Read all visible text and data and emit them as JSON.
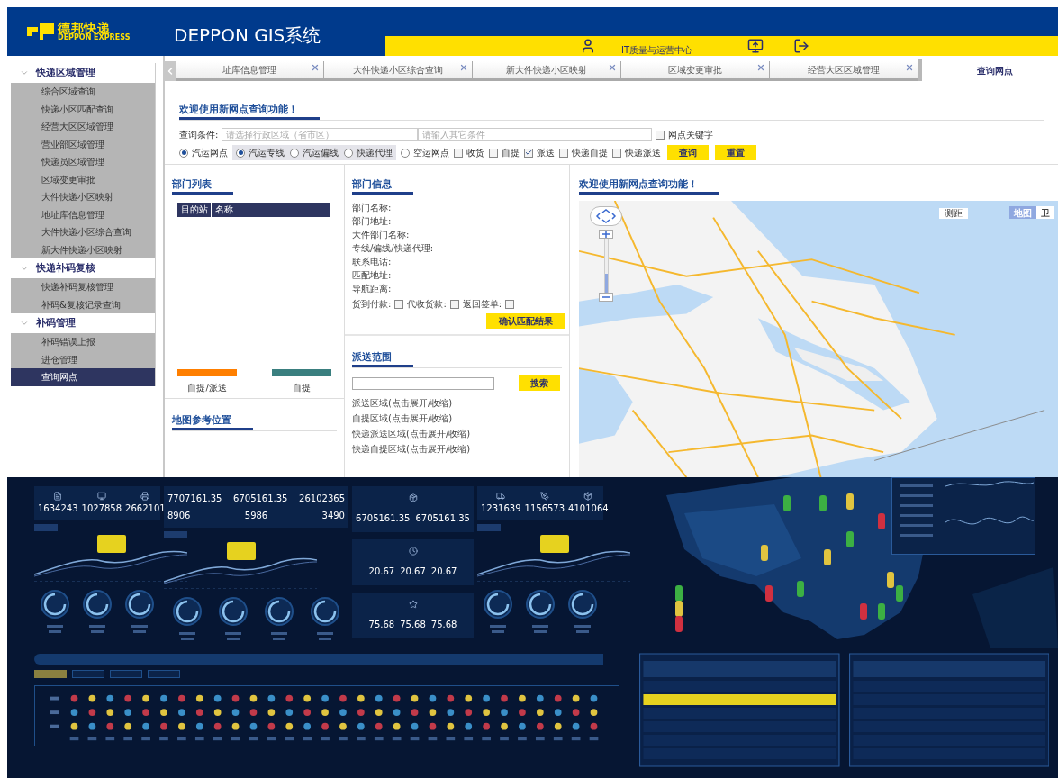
{
  "header": {
    "logo_cn": "德邦快递",
    "logo_en": "DEPPON EXPRESS",
    "title": "DEPPON GIS系统",
    "user": "IT质量与运营中心"
  },
  "sidebar": [
    {
      "label": "快递区域管理",
      "expanded": true,
      "children": [
        {
          "label": "综合区域查询",
          "selected": false
        },
        {
          "label": "快递小区匹配查询",
          "selected": false
        },
        {
          "label": "经营大区区域管理",
          "selected": false
        },
        {
          "label": "营业部区域管理",
          "selected": false
        },
        {
          "label": "快递员区域管理",
          "selected": false
        },
        {
          "label": "区域变更审批",
          "selected": false
        },
        {
          "label": "大件快递小区映射",
          "selected": false
        },
        {
          "label": "地址库信息管理",
          "selected": false
        },
        {
          "label": "大件快递小区综合查询",
          "selected": false
        },
        {
          "label": "新大件快递小区映射",
          "selected": false
        }
      ]
    },
    {
      "label": "快递补码复核",
      "expanded": true,
      "children": [
        {
          "label": "快递补码复核管理",
          "selected": false
        },
        {
          "label": "补码&复核记录查询",
          "selected": false
        }
      ]
    },
    {
      "label": "补码管理",
      "expanded": true,
      "children": [
        {
          "label": "补码错误上报",
          "selected": false
        },
        {
          "label": "进仓管理",
          "selected": false
        },
        {
          "label": "查询网点",
          "selected": true
        }
      ]
    }
  ],
  "tabs": [
    {
      "label": "址库信息管理",
      "selected": false
    },
    {
      "label": "大件快递小区综合查询",
      "selected": false
    },
    {
      "label": "新大件快递小区映射",
      "selected": false
    },
    {
      "label": "区域变更审批",
      "selected": false
    },
    {
      "label": "经营大区区域管理",
      "selected": false
    },
    {
      "label": "查询网点",
      "selected": true
    }
  ],
  "query": {
    "title": "欢迎使用新网点查询功能！",
    "label": "查询条件:",
    "region_placeholder": "请选择行政区域（省市区）",
    "other_placeholder": "请输入其它条件",
    "keyword": {
      "label": "网点关键字",
      "checked": false
    },
    "options": [
      {
        "kind": "radio",
        "label": "汽运网点",
        "checked": true
      },
      {
        "kind": "group",
        "items": [
          {
            "label": "汽运专线",
            "checked": true
          },
          {
            "label": "汽运偏线",
            "checked": false
          },
          {
            "label": "快递代理",
            "checked": false
          }
        ]
      },
      {
        "kind": "radio",
        "label": "空运网点",
        "checked": false
      },
      {
        "kind": "checkbox",
        "label": "收货",
        "checked": false
      },
      {
        "kind": "checkbox",
        "label": "自提",
        "checked": false
      },
      {
        "kind": "checkbox",
        "label": "派送",
        "checked": true
      },
      {
        "kind": "checkbox",
        "label": "快递自提",
        "checked": false
      },
      {
        "kind": "checkbox",
        "label": "快递派送",
        "checked": false
      }
    ],
    "buttons": [
      "查询",
      "重置"
    ]
  },
  "departments": {
    "title": "部门列表",
    "columns": [
      "目的站",
      "名称"
    ],
    "legend": [
      {
        "label": "自提/派送",
        "color": "#ff7f00"
      },
      {
        "label": "自提",
        "color": "#3a7f7f"
      }
    ],
    "map_section": "地图参考位置"
  },
  "info": {
    "title": "部门信息",
    "fields": [
      "部门名称:",
      "部门地址:",
      "大件部门名称:",
      "专线/偏线/快递代理:",
      "联系电话:",
      "匹配地址:",
      "导航距离:"
    ],
    "flags": [
      {
        "label": "货到付款:",
        "checked": false
      },
      {
        "label": "代收货款:",
        "checked": false
      },
      {
        "label": "返回签单:",
        "checked": false
      }
    ],
    "confirm": "确认匹配结果"
  },
  "delivery": {
    "title": "派送范围",
    "search": "搜索",
    "links": [
      "派送区域(点击展开/收缩)",
      "自提区域(点击展开/收缩)",
      "快递派送区域(点击展开/收缩)",
      "快递自提区域(点击展开/收缩)"
    ]
  },
  "map": {
    "title": "欢迎使用新网点查询功能！",
    "measure": "测距",
    "zoom": {
      "level": 0.35
    },
    "types": [
      {
        "label": "地图",
        "selected": true
      },
      {
        "label": "卫",
        "selected": false
      }
    ]
  },
  "dashboard": {
    "filters": [
      {
        "selected": true
      },
      {
        "selected": false
      },
      {
        "selected": false
      },
      {
        "selected": false
      }
    ],
    "columns": [
      {
        "kind": "metrics",
        "icons": true,
        "rows": [
          [
            "1634243",
            "1027858",
            "2662101"
          ]
        ]
      },
      {
        "kind": "metrics",
        "icons": false,
        "rows": [
          [
            "7707161.35",
            "6705161.35",
            "26102365"
          ],
          [
            "8906",
            "5986",
            "3490"
          ]
        ]
      },
      {
        "kind": "cards",
        "cards": [
          [
            "6705161.35",
            "6705161.35"
          ],
          [
            "20.67",
            "20.67",
            "20.67"
          ],
          [
            "75.68",
            "75.68",
            "75.68"
          ]
        ]
      },
      {
        "kind": "metrics",
        "icons": true,
        "rows": [
          [
            "1231639",
            "1156573",
            "4101064"
          ]
        ]
      }
    ]
  }
}
